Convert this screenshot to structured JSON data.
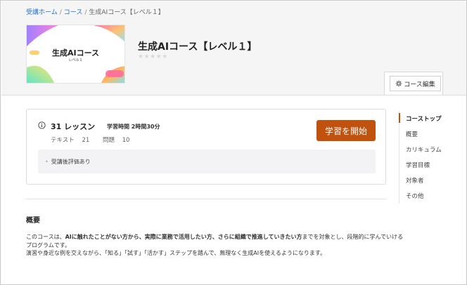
{
  "breadcrumb": {
    "home": "受講ホーム",
    "courses": "コース",
    "current": "生成AIコース【レベル１】"
  },
  "thumbnail": {
    "title": "生成AIコース",
    "subtitle": "レベル１"
  },
  "course": {
    "title": "生成AIコース【レベル１】",
    "stars": "★★★★★"
  },
  "edit_button": {
    "label": "コース編集",
    "icon": "gear-icon"
  },
  "lessons": {
    "count": "31 レッスン",
    "study_time": "学習時間 2時間30分",
    "text_label": "テキスト",
    "text_count": "21",
    "quiz_label": "問題",
    "quiz_count": "10",
    "start_label": "学習を開始",
    "evaluation": "受講後評価あり"
  },
  "sidenav": {
    "items": [
      {
        "label": "コーストップ",
        "active": true
      },
      {
        "label": "概要"
      },
      {
        "label": "カリキュラム"
      },
      {
        "label": "学習目標"
      },
      {
        "label": "対象者"
      },
      {
        "label": "その他"
      }
    ]
  },
  "overview": {
    "title": "概要",
    "p1_a": "このコースは、",
    "p1_b": "AIに触れたことがない方から、実際に業務で活用したい方、さらに組織で推進していきたい方",
    "p1_c": "までを対象とし、段階的に学んでいけるプログラムです。",
    "p2": "演習や身近な例を交えながら、「知る」「試す」「活かす」ステップを踏んで、無理なく生成AIを使えるようになります。"
  },
  "colors": {
    "accent": "#c0520e",
    "link": "#1f6fd0"
  }
}
